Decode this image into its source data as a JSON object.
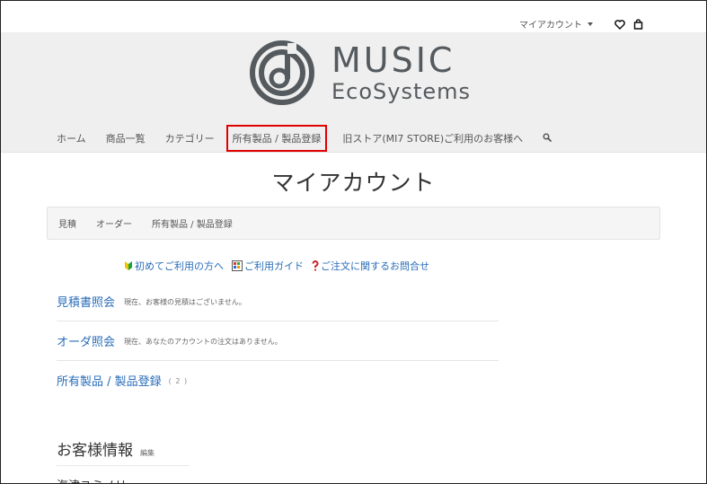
{
  "topbar": {
    "account_label": "マイアカウント"
  },
  "brand": {
    "line1": "MUSIC",
    "line2": "EcoSystems",
    "color": "#555a5e"
  },
  "nav": {
    "items": [
      {
        "label": "ホーム"
      },
      {
        "label": "商品一覧"
      },
      {
        "label": "カテゴリー"
      },
      {
        "label": "所有製品 / 製品登録"
      },
      {
        "label": "旧ストア(MI7 STORE)ご利用のお客様へ"
      }
    ]
  },
  "page": {
    "title": "マイアカウント"
  },
  "subnav": {
    "items": [
      {
        "label": "見積"
      },
      {
        "label": "オーダー"
      },
      {
        "label": "所有製品 / 製品登録"
      }
    ]
  },
  "help": {
    "first_time": "初めてご利用の方へ",
    "guide": "ご利用ガイド",
    "inquiry": "ご注文に関するお問合せ"
  },
  "sections": {
    "quotes": {
      "label": "見積書照会",
      "note": "現在、お客様の見積はございません。"
    },
    "orders": {
      "label": "オーダ照会",
      "note": "現在、あなたのアカウントの注文はありません。"
    },
    "products": {
      "label": "所有製品 / 製品登録",
      "count": "( 2 )"
    }
  },
  "customer": {
    "title": "お客様情報",
    "edit_label": "編集",
    "name": "海津ユミノリ"
  },
  "colors": {
    "link": "#2a6db8",
    "highlight": "#e00000",
    "header_bg": "#efefef"
  }
}
